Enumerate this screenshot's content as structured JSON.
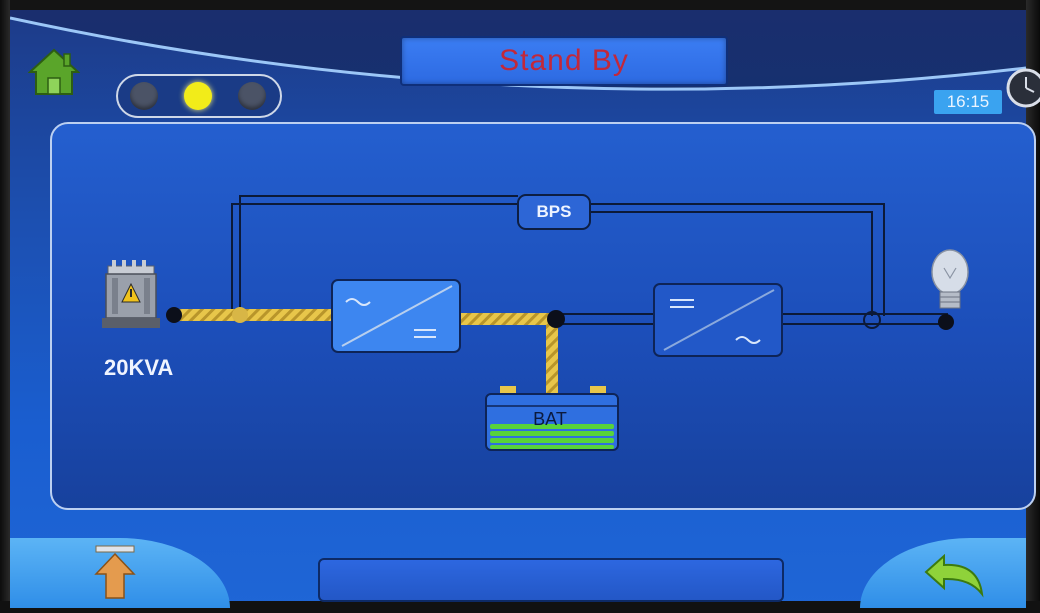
{
  "header": {
    "status_title": "Stand By",
    "time": "16:15"
  },
  "indicators": {
    "lights": [
      "off",
      "on",
      "off"
    ],
    "active_color": "#f2ec19",
    "inactive_color": "#4b5366"
  },
  "diagram": {
    "bypass_label": "BPS",
    "battery_label": "BAT",
    "source_label": "20KVA",
    "battery_level_bars": 4,
    "active_path_color": "#e8c64a"
  },
  "footer": {
    "message": ""
  },
  "icons": {
    "home": "home-icon",
    "clock": "clock-icon",
    "transformer": "transformer-icon",
    "rectifier": "rectifier-icon",
    "inverter": "inverter-icon",
    "battery": "battery-icon",
    "load": "light-bulb-icon",
    "page_up": "arrow-up-icon",
    "back": "return-arrow-icon"
  }
}
